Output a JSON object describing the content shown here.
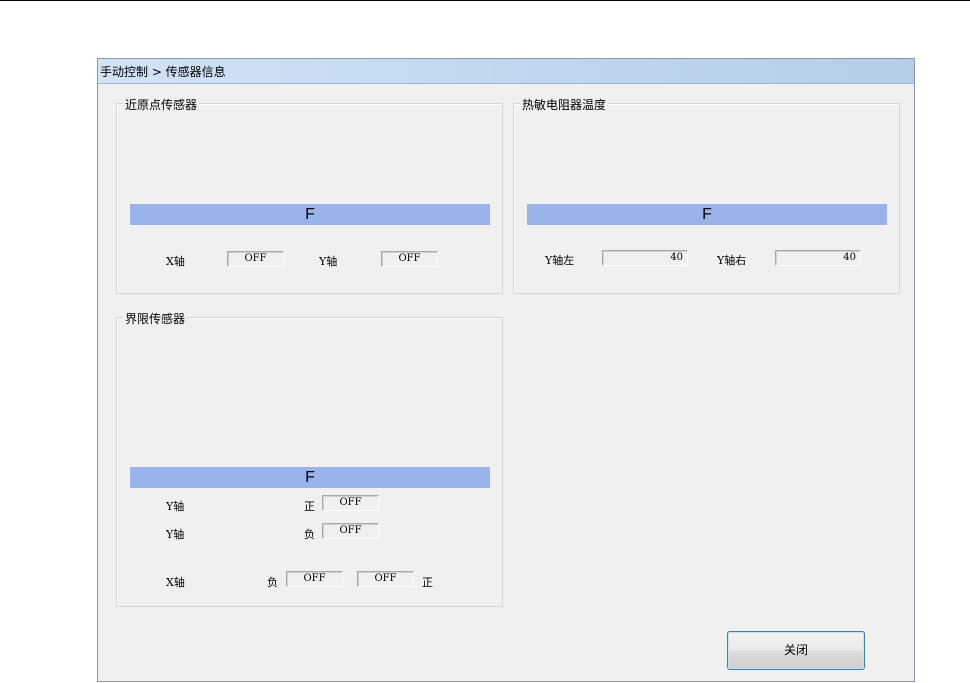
{
  "window": {
    "title": "手动控制 > 传感器信息"
  },
  "origin_sensor": {
    "legend": "近原点传感器",
    "bar_text": "F",
    "x_label": "X轴",
    "x_value": "OFF",
    "y_label": "Y轴",
    "y_value": "OFF"
  },
  "thermistor": {
    "legend": "热敏电阻器温度",
    "bar_text": "F",
    "left_label": "Y轴左",
    "left_value": "40",
    "right_label": "Y轴右",
    "right_value": "40"
  },
  "limit_sensor": {
    "legend": "界限传感器",
    "bar_text": "F",
    "row1": {
      "axis": "Y轴",
      "dir": "正",
      "value": "OFF"
    },
    "row2": {
      "axis": "Y轴",
      "dir": "负",
      "value": "OFF"
    },
    "row3": {
      "axis": "X轴",
      "neg_label": "负",
      "neg_value": "OFF",
      "pos_value": "OFF",
      "pos_label": "正"
    }
  },
  "close_button": {
    "label": "关闭"
  }
}
